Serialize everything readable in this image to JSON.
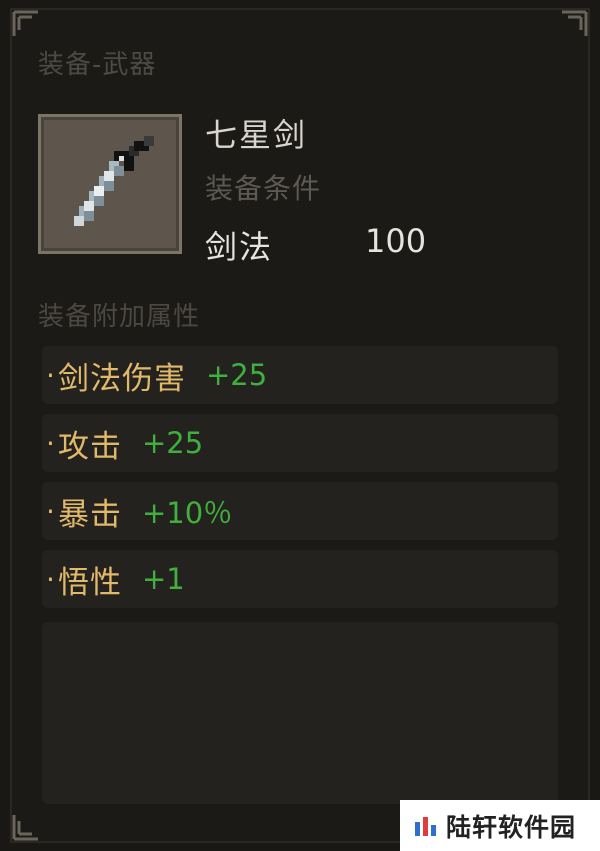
{
  "category": "装备-武器",
  "item": {
    "name": "七星剑",
    "icon": "sword-icon",
    "requirement": {
      "title": "装备条件",
      "skill": "剑法",
      "value": "100"
    }
  },
  "bonus_section": {
    "title": "装备附加属性",
    "attributes": [
      {
        "bullet": "·",
        "name": "剑法伤害",
        "value": "+25"
      },
      {
        "bullet": "·",
        "name": "攻击",
        "value": "+25"
      },
      {
        "bullet": "·",
        "name": "暴击",
        "value": "+10％"
      },
      {
        "bullet": "·",
        "name": "悟性",
        "value": "+1"
      }
    ]
  },
  "watermark": {
    "text": "陆轩软件园",
    "icon": "logo-icon"
  },
  "colors": {
    "attribute_name": "#e1b96a",
    "attribute_value": "#3fb03d",
    "panel_bg": "#1c1a17"
  }
}
